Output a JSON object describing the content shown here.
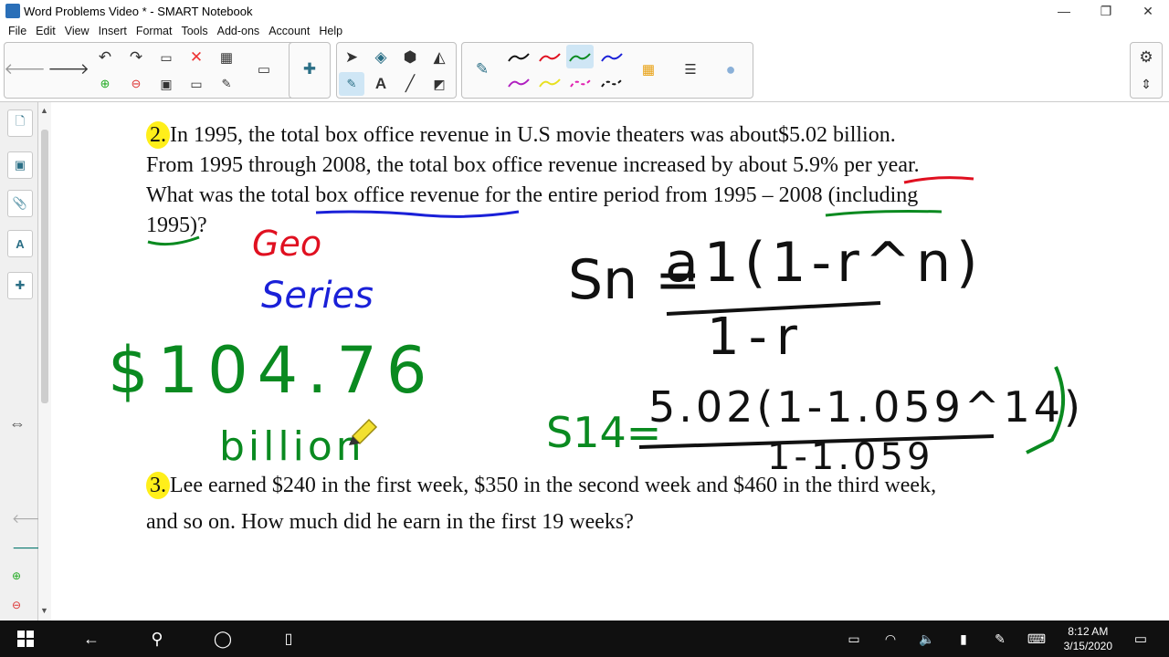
{
  "window": {
    "title": "Word Problems Video * - SMART Notebook",
    "minimize": "—",
    "maximize": "❐",
    "close": "✕"
  },
  "menu": [
    "File",
    "Edit",
    "View",
    "Insert",
    "Format",
    "Tools",
    "Add-ons",
    "Account",
    "Help"
  ],
  "problem2": {
    "number": "2.",
    "line1": "In 1995, the total box office revenue in U.S movie theaters was about$5.02 billion.",
    "line2": "From 1995 through 2008, the total box office revenue increased by about 5.9% per year.",
    "line3": "What was the total box office revenue for the entire period from 1995 – 2008 (including",
    "line4": "1995)?"
  },
  "problem3": {
    "number": "3.",
    "line1": "Lee earned $240 in the first week, $350 in the second week and $460 in the third week,",
    "line2": "and so on. How much did he earn in the first 19 weeks?"
  },
  "handwriting": {
    "geo": "Geo",
    "series": "Series",
    "answer": "$104.76",
    "billion": "billion",
    "formula_lhs": "Sn =",
    "formula_num": "a1(1-r^n)",
    "formula_den": "1-r",
    "s14": "S14=",
    "calc_num": "5.02(1-1.059^14)",
    "calc_den": "1-1.059"
  },
  "colors": {
    "ink_black": "#111111",
    "ink_red": "#e01020",
    "ink_blue": "#1a20d8",
    "ink_green": "#0a8a20",
    "highlight_yellow": "#ffef1a"
  },
  "taskbar": {
    "time": "8:12 AM",
    "date": "3/15/2020"
  }
}
